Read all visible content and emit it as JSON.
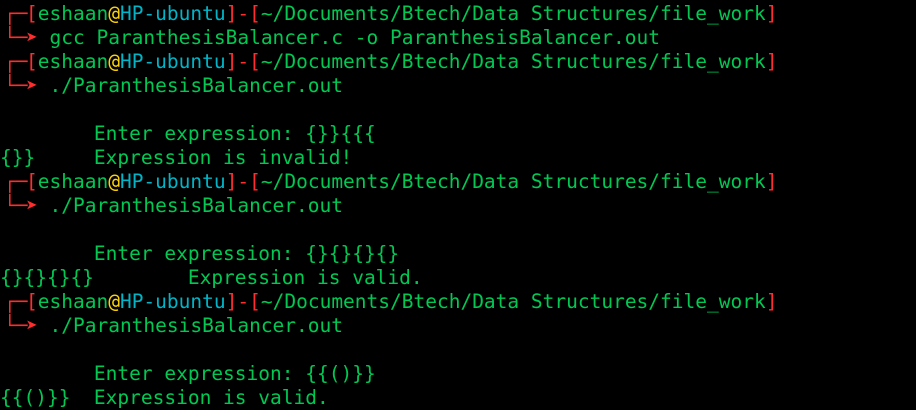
{
  "colors": {
    "background": "#000000",
    "text_green": "#00c853",
    "prompt_red": "#ff2d2d",
    "at_yellow": "#ffd400",
    "host_cyan": "#00b5c8"
  },
  "prompt": {
    "branch_top": "┌─",
    "branch_bottom": "└─",
    "open_bracket": "[",
    "close_bracket": "]",
    "user": "eshaan",
    "at": "@",
    "host": "HP-ubuntu",
    "separator": "-",
    "path": "~/Documents/Btech/Data Structures/file_work",
    "arrow": "➤"
  },
  "session": [
    {
      "command": "gcc ParanthesisBalancer.c -o ParanthesisBalancer.out"
    },
    {
      "command": "./ParanthesisBalancer.out",
      "output": [
        "",
        "        Enter expression: {}}{{{",
        "{}}     Expression is invalid!"
      ]
    },
    {
      "command": "./ParanthesisBalancer.out",
      "output": [
        "",
        "        Enter expression: {}{}{}{}",
        "{}{}{}{}        Expression is valid."
      ]
    },
    {
      "command": "./ParanthesisBalancer.out",
      "output": [
        "",
        "        Enter expression: {{()}}",
        "{{()}}  Expression is valid."
      ]
    }
  ]
}
